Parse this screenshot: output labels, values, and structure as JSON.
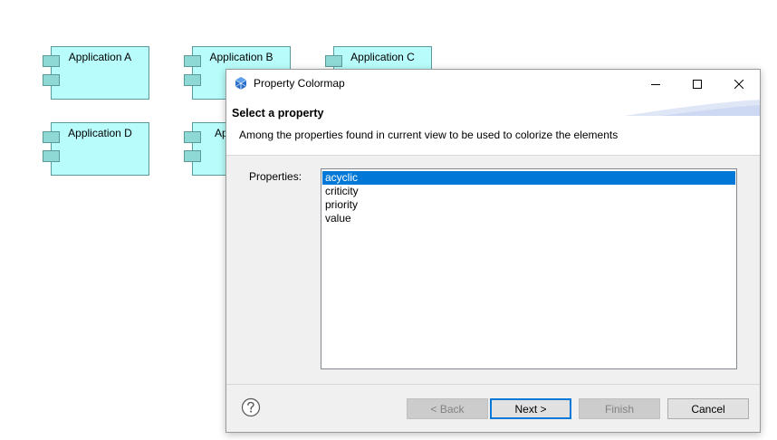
{
  "diagram": {
    "components": [
      {
        "label": "Application A"
      },
      {
        "label": "Application B"
      },
      {
        "label": "Application C"
      },
      {
        "label": "Application D"
      },
      {
        "label": "Ap"
      }
    ]
  },
  "dialog": {
    "title": "Property Colormap",
    "header": {
      "title": "Select a property",
      "description": "Among the properties found in current view to be used to colorize the elements"
    },
    "properties_label": "Properties:",
    "properties": [
      {
        "label": "acyclic",
        "selected": true
      },
      {
        "label": "criticity",
        "selected": false
      },
      {
        "label": "priority",
        "selected": false
      },
      {
        "label": "value",
        "selected": false
      }
    ],
    "buttons": {
      "back": "< Back",
      "next": "Next >",
      "finish": "Finish",
      "cancel": "Cancel"
    },
    "colors": {
      "selection": "#0078d7",
      "component_fill": "#b8fdfb"
    }
  }
}
